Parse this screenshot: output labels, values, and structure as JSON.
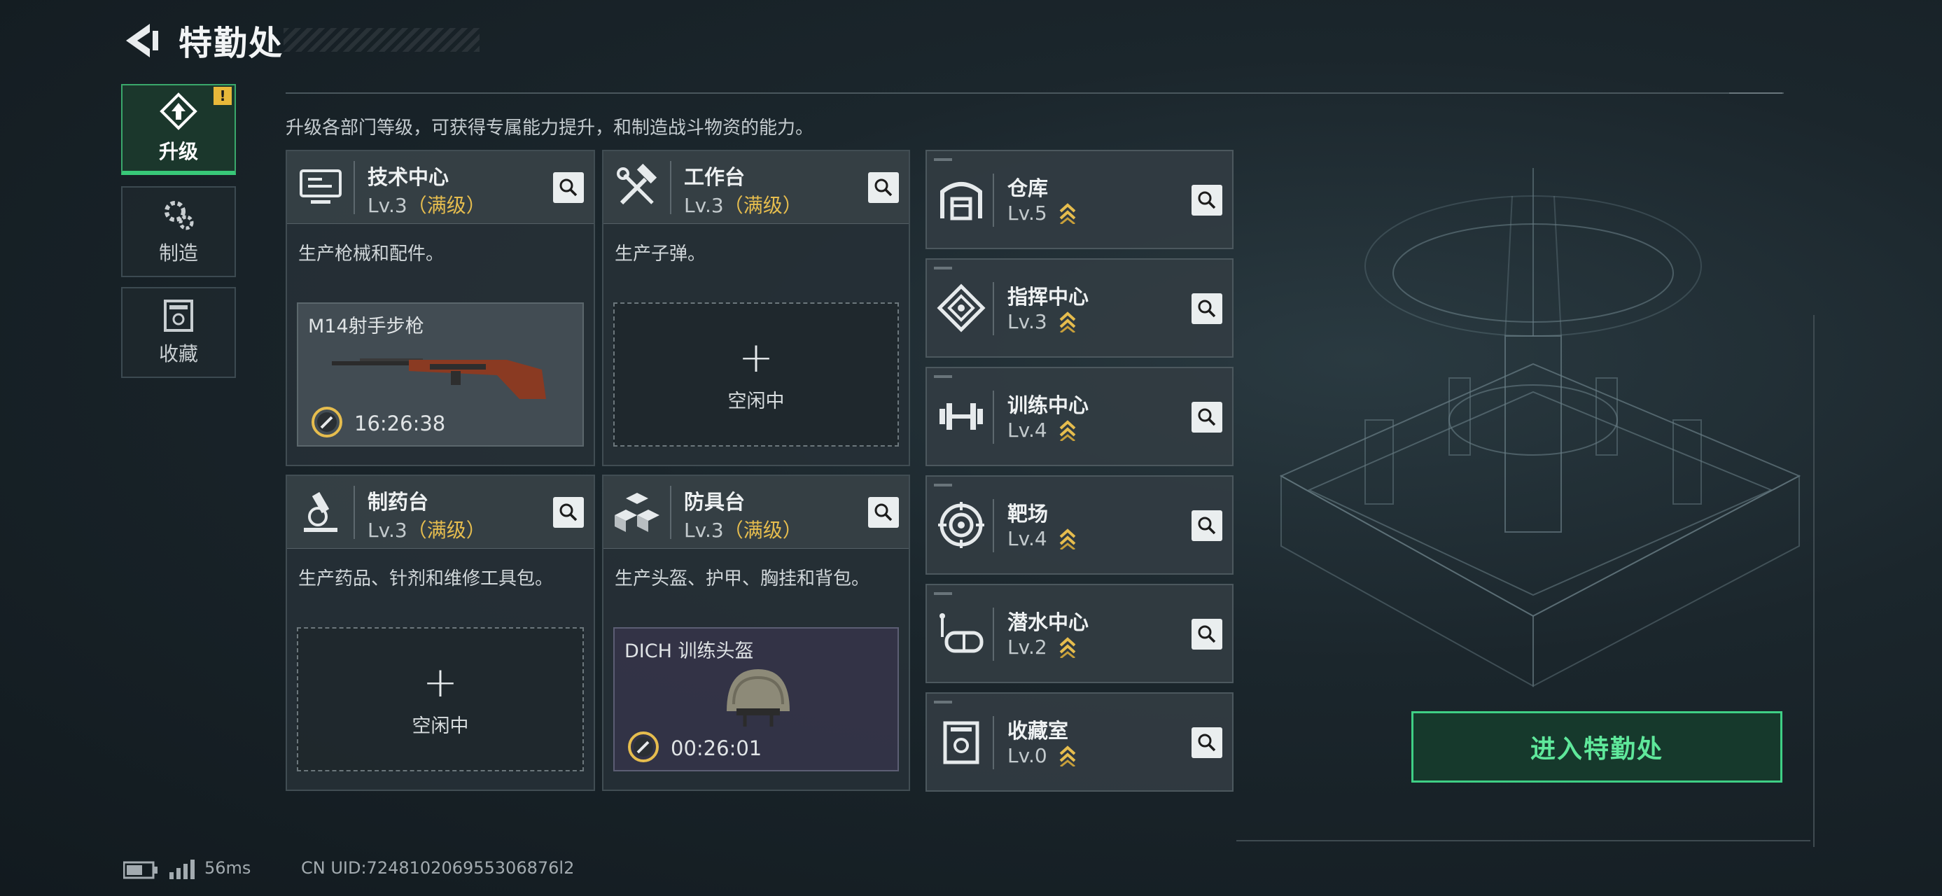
{
  "header": {
    "title": "特勤处"
  },
  "tabs": [
    {
      "label": "升级",
      "icon": "upgrade-icon",
      "active": true,
      "alert": "!"
    },
    {
      "label": "制造",
      "icon": "gears-icon",
      "active": false
    },
    {
      "label": "收藏",
      "icon": "collection-icon",
      "active": false
    }
  ],
  "intro": "升级各部门等级，可获得专属能力提升，和制造战斗物资的能力。",
  "departments": [
    {
      "name": "技术中心",
      "level": "Lv.3",
      "max_label": "（满级）",
      "icon": "computer-icon",
      "desc": "生产枪械和配件。",
      "slot": {
        "type": "item",
        "name": "M14射手步枪",
        "timer": "16:26:38",
        "item_icon": "rifle-icon"
      }
    },
    {
      "name": "工作台",
      "level": "Lv.3",
      "max_label": "（满级）",
      "icon": "tools-icon",
      "desc": "生产子弹。",
      "slot": {
        "type": "empty",
        "plus": "+",
        "label": "空闲中"
      }
    },
    {
      "name": "制药台",
      "level": "Lv.3",
      "max_label": "（满级）",
      "icon": "microscope-icon",
      "desc": "生产药品、针剂和维修工具包。",
      "slot": {
        "type": "empty",
        "plus": "+",
        "label": "空闲中"
      }
    },
    {
      "name": "防具台",
      "level": "Lv.3",
      "max_label": "（满级）",
      "icon": "armor-boxes-icon",
      "desc": "生产头盔、护甲、胸挂和背包。",
      "slot": {
        "type": "item",
        "name": "DICH 训练头盔",
        "timer": "00:26:01",
        "item_icon": "helmet-icon"
      }
    }
  ],
  "facilities": [
    {
      "name": "仓库",
      "level": "Lv.5",
      "icon": "warehouse-icon"
    },
    {
      "name": "指挥中心",
      "level": "Lv.3",
      "icon": "command-icon"
    },
    {
      "name": "训练中心",
      "level": "Lv.4",
      "icon": "dumbbell-icon"
    },
    {
      "name": "靶场",
      "level": "Lv.4",
      "icon": "target-icon"
    },
    {
      "name": "潜水中心",
      "level": "Lv.2",
      "icon": "dive-mask-icon"
    },
    {
      "name": "收藏室",
      "level": "Lv.0",
      "icon": "collection-room-icon"
    }
  ],
  "enter_button": "进入特勤处",
  "status_bar": {
    "ping": "56ms",
    "uid": "CN UID:724810206955306876l2"
  },
  "colors": {
    "accent_green": "#3fcf85",
    "max_level_gold": "#e6bd4e",
    "alert_yellow": "#e8b83a"
  }
}
